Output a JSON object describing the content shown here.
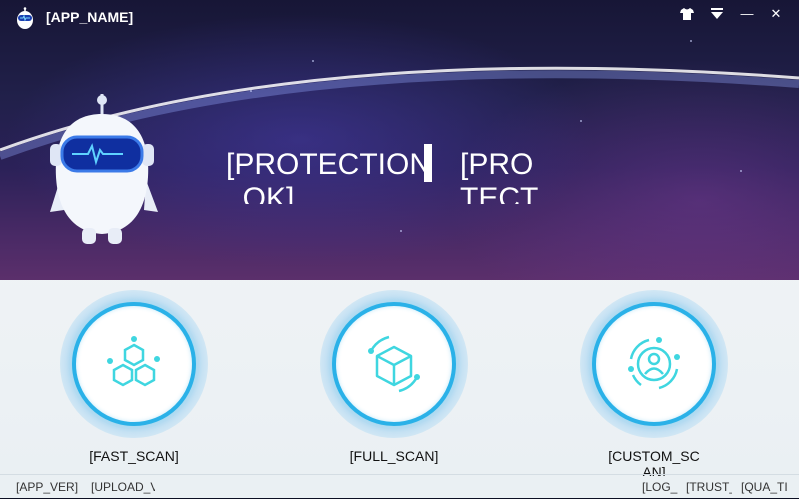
{
  "titlebar": {
    "app_name": "[APP_NAME]",
    "icons": [
      "shirt-icon",
      "menu-dropdown-icon",
      "minimize-icon",
      "close-icon"
    ],
    "minimize_glyph": "—",
    "close_glyph": "✕"
  },
  "hero": {
    "status_main": "[PROTECTION_OK]",
    "status_sub": "[PROTECTI"
  },
  "scans": [
    {
      "label": "[FAST_SCAN]",
      "icon": "hexagon-molecule-icon"
    },
    {
      "label": "[FULL_SCAN]",
      "icon": "cube-icon"
    },
    {
      "label": "[CUSTOM_SCAN]",
      "icon": "user-target-icon"
    }
  ],
  "footer": {
    "app_version": "[APP_VER]",
    "upload": "[UPLOAD_V",
    "log": "[LOG_",
    "trust": "[TRUST_",
    "quarantine": "[QUA_TI"
  },
  "colors": {
    "accent": "#2ab1e8",
    "icon_cyan": "#3fd6e0",
    "hero_dark": "#171636",
    "panel": "#f3f7f9"
  }
}
